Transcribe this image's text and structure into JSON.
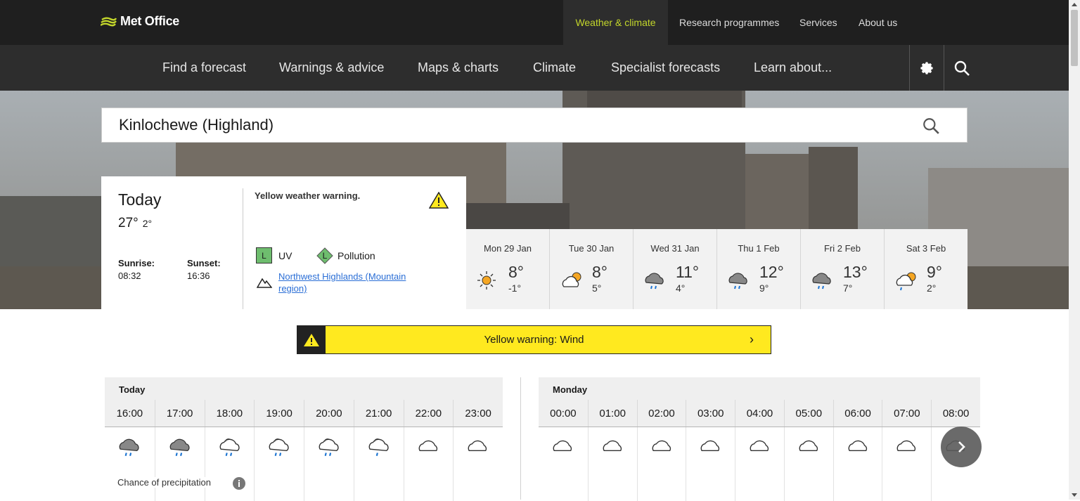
{
  "brand": {
    "name": "Met Office"
  },
  "top_nav": [
    "Weather & climate",
    "Research programmes",
    "Services",
    "About us"
  ],
  "main_nav": [
    "Find a forecast",
    "Warnings & advice",
    "Maps & charts",
    "Climate",
    "Specialist forecasts",
    "Learn about..."
  ],
  "search": {
    "value": "Kinlochewe (Highland)"
  },
  "today": {
    "title": "Today",
    "high": "27°",
    "low": "2°",
    "sunrise_label": "Sunrise:",
    "sunrise": "08:32",
    "sunset_label": "Sunset:",
    "sunset": "16:36",
    "warning_text": "Yellow weather warning.",
    "uv_level": "L",
    "uv_label": "UV",
    "pollution_level": "L",
    "pollution_label": "Pollution",
    "mountain_link": "Northwest Highlands (Mountain region)"
  },
  "days": [
    {
      "name": "Mon 29 Jan",
      "high": "8°",
      "low": "-1°",
      "icon": "sunny"
    },
    {
      "name": "Tue 30 Jan",
      "high": "8°",
      "low": "5°",
      "icon": "sunny-intervals"
    },
    {
      "name": "Wed 31 Jan",
      "high": "11°",
      "low": "4°",
      "icon": "light-rain"
    },
    {
      "name": "Thu 1 Feb",
      "high": "12°",
      "low": "9°",
      "icon": "light-rain"
    },
    {
      "name": "Fri 2 Feb",
      "high": "13°",
      "low": "7°",
      "icon": "light-rain"
    },
    {
      "name": "Sat 3 Feb",
      "high": "9°",
      "low": "2°",
      "icon": "sunny-shower"
    }
  ],
  "warning_banner": {
    "text": "Yellow warning: Wind",
    "color": "#ffe91f"
  },
  "hourly": {
    "today_label": "Today",
    "monday_label": "Monday",
    "precip_label": "Chance of precipitation",
    "today_hours": [
      {
        "time": "16:00",
        "icon": "heavy-rain-cloud"
      },
      {
        "time": "17:00",
        "icon": "heavy-rain-cloud"
      },
      {
        "time": "18:00",
        "icon": "light-rain-cloud"
      },
      {
        "time": "19:00",
        "icon": "light-rain-cloud"
      },
      {
        "time": "20:00",
        "icon": "light-rain-cloud"
      },
      {
        "time": "21:00",
        "icon": "drizzle-cloud"
      },
      {
        "time": "22:00",
        "icon": "cloudy"
      },
      {
        "time": "23:00",
        "icon": "cloudy"
      }
    ],
    "monday_hours": [
      {
        "time": "00:00",
        "icon": "cloudy"
      },
      {
        "time": "01:00",
        "icon": "cloudy"
      },
      {
        "time": "02:00",
        "icon": "cloudy"
      },
      {
        "time": "03:00",
        "icon": "cloudy"
      },
      {
        "time": "04:00",
        "icon": "cloudy"
      },
      {
        "time": "05:00",
        "icon": "cloudy"
      },
      {
        "time": "06:00",
        "icon": "cloudy"
      },
      {
        "time": "07:00",
        "icon": "cloudy"
      },
      {
        "time": "08:00",
        "icon": "cloudy"
      }
    ]
  },
  "colors": {
    "accent": "#c3d62b",
    "header": "#1f1f1f",
    "nav": "#2d2d2d",
    "link": "#2a6ed6"
  }
}
